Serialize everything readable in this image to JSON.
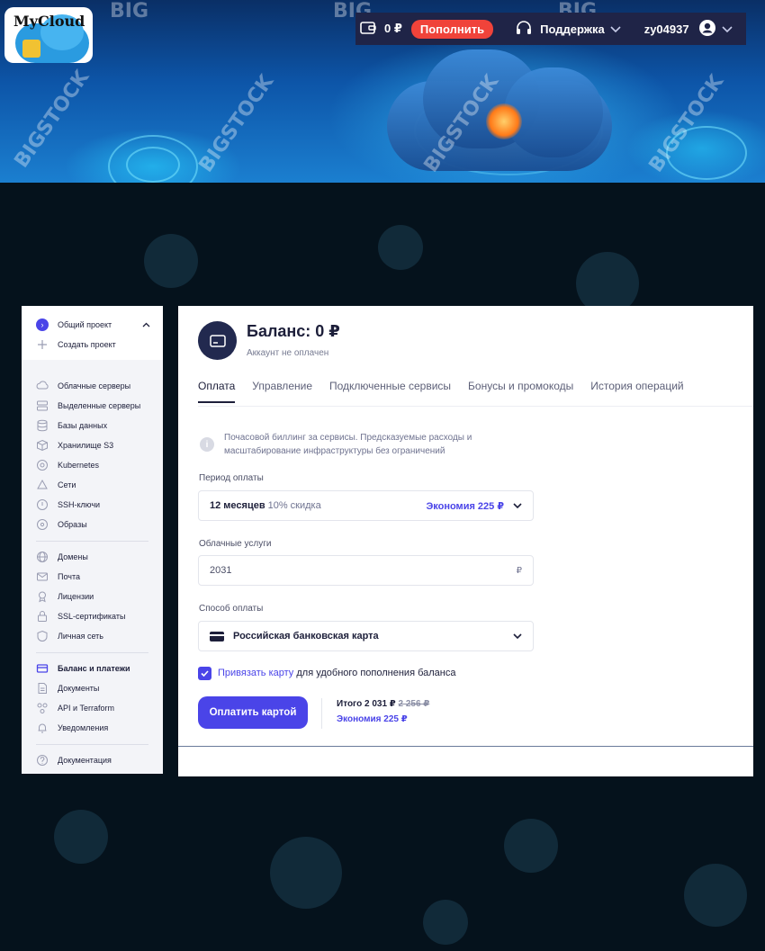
{
  "brand": {
    "logo_text": "MyCloud"
  },
  "watermarks": [
    "BIG",
    "BIG",
    "BIG",
    "BIGSTOCK",
    "BIGSTOCK",
    "BIGSTOCK",
    "BIGSTOCK"
  ],
  "topbar": {
    "balance": "0 ₽",
    "topup_label": "Пополнить",
    "support_label": "Поддержка",
    "username": "zy04937"
  },
  "sidebar": {
    "project_name": "Общий проект",
    "create_project": "Создать проект",
    "group1": [
      {
        "label": "Облачные серверы",
        "icon": "cloud-icon"
      },
      {
        "label": "Выделенные серверы",
        "icon": "server-icon"
      },
      {
        "label": "Базы данных",
        "icon": "database-icon"
      },
      {
        "label": "Хранилище S3",
        "icon": "box-icon"
      },
      {
        "label": "Kubernetes",
        "icon": "kubernetes-icon"
      },
      {
        "label": "Сети",
        "icon": "network-icon"
      },
      {
        "label": "SSH-ключи",
        "icon": "key-icon"
      },
      {
        "label": "Образы",
        "icon": "disk-icon"
      }
    ],
    "group2": [
      {
        "label": "Домены",
        "icon": "globe-icon"
      },
      {
        "label": "Почта",
        "icon": "mail-icon"
      },
      {
        "label": "Лицензии",
        "icon": "license-icon"
      },
      {
        "label": "SSL-сертификаты",
        "icon": "lock-icon"
      },
      {
        "label": "Личная сеть",
        "icon": "shield-icon"
      }
    ],
    "group3": [
      {
        "label": "Баланс и платежи",
        "icon": "card-icon",
        "active": true
      },
      {
        "label": "Документы",
        "icon": "document-icon"
      },
      {
        "label": "API и Terraform",
        "icon": "api-icon"
      },
      {
        "label": "Уведомления",
        "icon": "bell-icon"
      }
    ],
    "group4": [
      {
        "label": "Документация",
        "icon": "help-icon"
      }
    ]
  },
  "main": {
    "title": "Баланс: 0 ₽",
    "subtitle": "Аккаунт не оплачен",
    "tabs": [
      "Оплата",
      "Управление",
      "Подключенные сервисы",
      "Бонусы и промокоды",
      "История операций"
    ],
    "info_text": "Почасовой биллинг за сервисы. Предсказуемые расходы и масштабирование инфраструктуры без ограничений",
    "period": {
      "label": "Период оплаты",
      "value": "12 месяцев",
      "discount": "10% скидка",
      "saving": "Экономия 225 ₽"
    },
    "services": {
      "label": "Облачные услуги",
      "value": "2031",
      "currency": "₽"
    },
    "payment_method": {
      "label": "Способ оплаты",
      "value": "Российская банковская карта"
    },
    "bind_card": {
      "link": "Привязать карту",
      "rest": " для удобного пополнения баланса",
      "checked": true
    },
    "pay_button": "Оплатить картой",
    "total_label": "Итого 2 031 ₽",
    "total_old": "2 256 ₽",
    "total_saving": "Экономия 225 ₽"
  },
  "colors": {
    "accent": "#4a44e8",
    "topup": "#f0433a",
    "topbar_bg": "#1f2447",
    "icon_bg": "#22294f"
  }
}
